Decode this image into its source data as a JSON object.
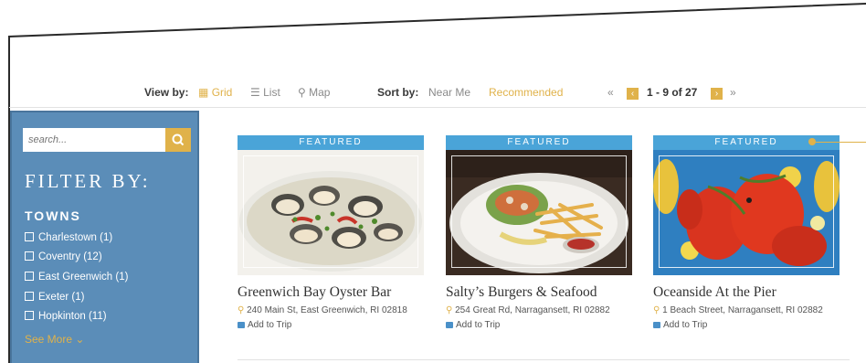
{
  "viewbar": {
    "view_by_label": "View by:",
    "grid_label": "Grid",
    "list_label": "List",
    "map_label": "Map",
    "sort_by_label": "Sort by:",
    "near_me_label": "Near Me",
    "recommended_label": "Recommended",
    "first_page": "«",
    "prev_page": "‹",
    "range": "1 - 9 of 27",
    "next_page": "›",
    "last_page": "»"
  },
  "sidebar": {
    "search_placeholder": "search...",
    "filter_title": "FILTER BY:",
    "towns_title": "TOWNS",
    "towns": [
      {
        "label": "Charlestown (1)"
      },
      {
        "label": "Coventry (12)"
      },
      {
        "label": "East Greenwich (1)"
      },
      {
        "label": "Exeter (1)"
      },
      {
        "label": "Hopkinton (11)"
      }
    ],
    "see_more": "See More"
  },
  "cards": [
    {
      "badge": "FEATURED",
      "title": "Greenwich Bay Oyster Bar",
      "address": "240 Main St, East Greenwich, RI 02818",
      "add_to_trip": "Add to Trip"
    },
    {
      "badge": "FEATURED",
      "title": "Salty’s Burgers & Seafood",
      "address": "254 Great Rd, Narragansett, RI 02882",
      "add_to_trip": "Add to Trip"
    },
    {
      "badge": "FEATURED",
      "title": "Oceanside At the Pier",
      "address": "1 Beach Street, Narragansett, RI 02882",
      "add_to_trip": "Add to Trip"
    }
  ],
  "colors": {
    "accent": "#e0b24a",
    "sidebar": "#5b8db8",
    "badge": "#4aa4d8"
  }
}
